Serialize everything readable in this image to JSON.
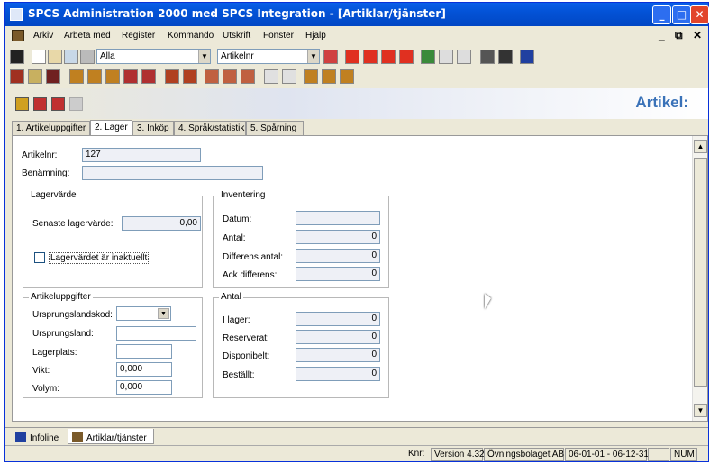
{
  "window": {
    "title": "SPCS Administration 2000 med SPCS Integration - [Artiklar/tjänster]"
  },
  "menu": {
    "items": [
      "Arkiv",
      "Arbeta med",
      "Register",
      "Kommando",
      "Utskrift",
      "Fönster",
      "Hjälp"
    ],
    "window_controls": [
      "_",
      "⧉",
      "✕"
    ]
  },
  "toolbar": {
    "filter_combo": "Alla",
    "sort_combo": "Artikelnr"
  },
  "banner": {
    "heading": "Artikel:"
  },
  "tabs": [
    "1. Artikeluppgifter",
    "2. Lager",
    "3. Inköp",
    "4. Språk/statistik",
    "5. Spårning"
  ],
  "form": {
    "artikelnr_label": "Artikelnr:",
    "artikelnr_value": "127",
    "benamning_label": "Benämning:",
    "benamning_value": "",
    "lagervarde": {
      "title": "Lagervärde",
      "senaste_label": "Senaste lagervärde:",
      "senaste_value": "0,00",
      "inaktuellt_label": "Lagervärdet är inaktuellt"
    },
    "inventering": {
      "title": "Inventering",
      "datum_label": "Datum:",
      "datum_value": "",
      "antal_label": "Antal:",
      "antal_value": "0",
      "differens_antal_label": "Differens antal:",
      "differens_antal_value": "0",
      "ack_differens_label": "Ack differens:",
      "ack_differens_value": "0"
    },
    "artikeluppgifter": {
      "title": "Artikeluppgifter",
      "ursprungslandskod_label": "Ursprungslandskod:",
      "ursprungslandskod_value": "",
      "ursprungsland_label": "Ursprungsland:",
      "ursprungsland_value": "",
      "lagerplats_label": "Lagerplats:",
      "lagerplats_value": "",
      "vikt_label": "Vikt:",
      "vikt_value": "0,000",
      "volym_label": "Volym:",
      "volym_value": "0,000"
    },
    "antal": {
      "title": "Antal",
      "ilager_label": "I lager:",
      "ilager_value": "0",
      "reserverat_label": "Reserverat:",
      "reserverat_value": "0",
      "disponibelt_label": "Disponibelt:",
      "disponibelt_value": "0",
      "bestallt_label": "Beställt:",
      "bestallt_value": "0"
    }
  },
  "doc_tabs": [
    "Infoline",
    "Artiklar/tjänster"
  ],
  "status": {
    "knr": "Knr:",
    "version": "Version 4.32",
    "company": "Övningsbolaget AB",
    "period": "06-01-01 - 06-12-31",
    "num": "NUM"
  },
  "colors": {
    "titlebar": "#0352d6",
    "heading": "#3a72b8"
  }
}
